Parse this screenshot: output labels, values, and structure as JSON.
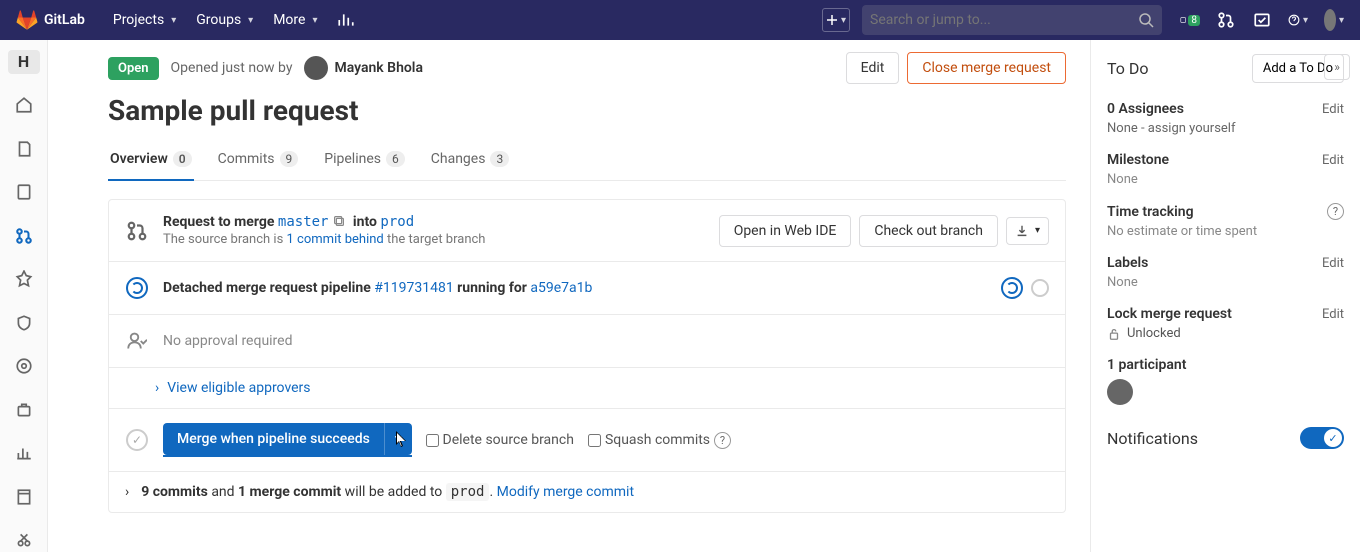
{
  "topnav": {
    "brand": "GitLab",
    "menu": [
      "Projects",
      "Groups",
      "More"
    ],
    "search_placeholder": "Search or jump to...",
    "issues_badge": "8"
  },
  "leftrail": {
    "project_letter": "H"
  },
  "mr": {
    "status": "Open",
    "opened_text": "Opened just now by",
    "author": "Mayank Bhola",
    "edit": "Edit",
    "close": "Close merge request",
    "title": "Sample pull request"
  },
  "tabs": {
    "overview": {
      "label": "Overview",
      "count": "0"
    },
    "commits": {
      "label": "Commits",
      "count": "9"
    },
    "pipelines": {
      "label": "Pipelines",
      "count": "6"
    },
    "changes": {
      "label": "Changes",
      "count": "3"
    }
  },
  "merge_box": {
    "request_prefix": "Request to merge",
    "source_branch": "master",
    "into": "into",
    "target_branch": "prod",
    "behind_prefix": "The source branch is",
    "behind_link": "1 commit behind",
    "behind_suffix": "the target branch",
    "open_ide": "Open in Web IDE",
    "checkout": "Check out branch"
  },
  "pipeline": {
    "prefix": "Detached merge request pipeline",
    "id": "#119731481",
    "mid": "running for",
    "sha": "a59e7a1b"
  },
  "approval": {
    "none": "No approval required",
    "view": "View eligible approvers"
  },
  "merge_action": {
    "button": "Merge when pipeline succeeds",
    "delete_branch": "Delete source branch",
    "squash": "Squash commits"
  },
  "commits_summary": {
    "count": "9 commits",
    "and": "and",
    "merge_commit": "1 merge commit",
    "suffix1": "will be added to",
    "target": "prod",
    "modify": "Modify merge commit"
  },
  "sidebar": {
    "todo_label": "To Do",
    "add_todo": "Add a To Do",
    "assignees_label": "0 Assignees",
    "assignees_val": "None - assign yourself",
    "milestone_label": "Milestone",
    "milestone_val": "None",
    "time_label": "Time tracking",
    "time_val": "No estimate or time spent",
    "labels_label": "Labels",
    "labels_val": "None",
    "lock_label": "Lock merge request",
    "lock_val": "Unlocked",
    "participant": "1 participant",
    "notifications": "Notifications",
    "edit": "Edit"
  }
}
